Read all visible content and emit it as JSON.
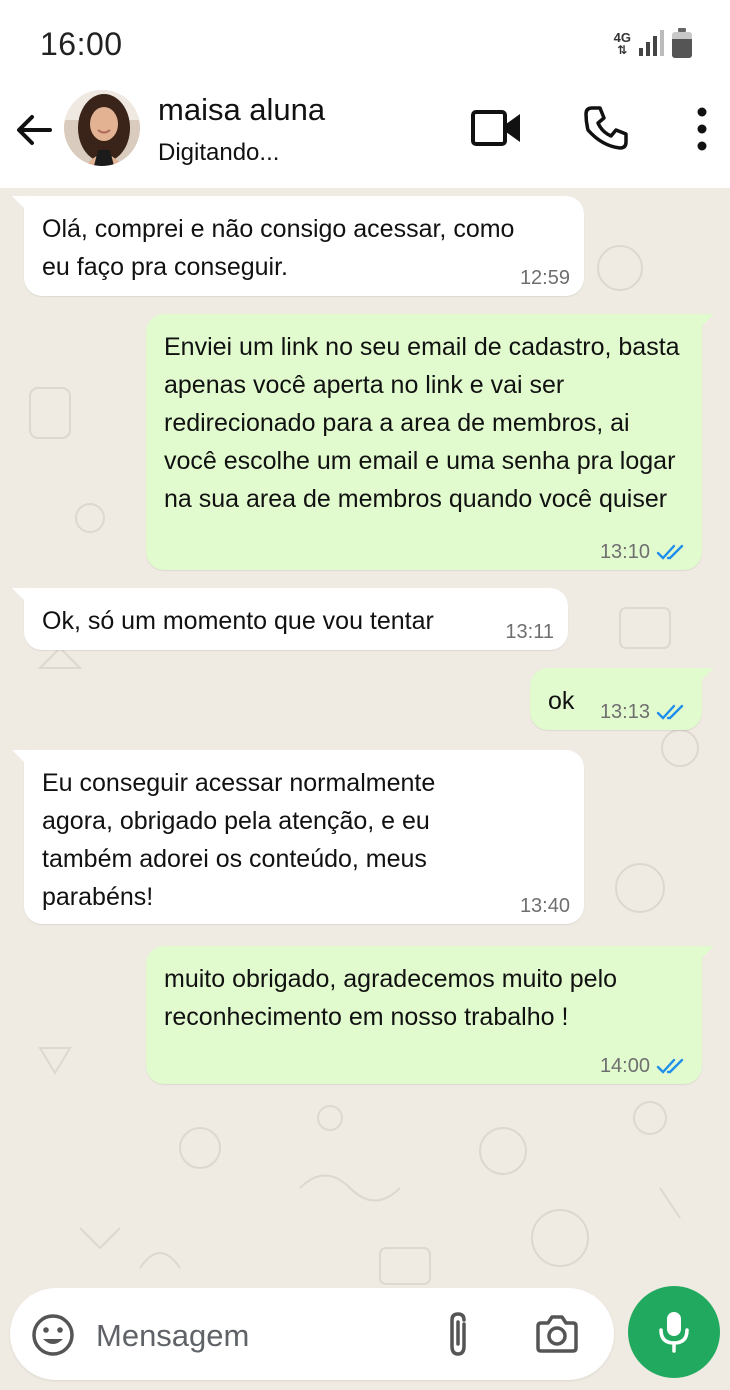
{
  "status_bar": {
    "time": "16:00",
    "network": "4G",
    "icons": [
      "network-4g-icon",
      "signal-icon",
      "battery-icon"
    ],
    "battery_level": 0.75
  },
  "header": {
    "contact_name": "maisa aluna",
    "contact_status": "Digitando...",
    "icons": [
      "back-arrow-icon",
      "video-call-icon",
      "phone-icon",
      "more-vert-icon"
    ]
  },
  "messages": [
    {
      "direction": "in",
      "text": "Olá, comprei e não consigo acessar, como eu faço pra conseguir.",
      "time": "12:59"
    },
    {
      "direction": "out",
      "text": "Enviei um link no seu email de cadastro, basta apenas você aperta no link e vai ser redirecionado para a area de membros, ai você escolhe um email e uma senha pra logar na sua area de membros quando você quiser",
      "time": "13:10",
      "read": true
    },
    {
      "direction": "in",
      "text": "Ok, só um momento que vou tentar",
      "time": "13:11"
    },
    {
      "direction": "out",
      "text": "ok",
      "time": "13:13",
      "read": true
    },
    {
      "direction": "in",
      "text": "Eu conseguir acessar normalmente agora, obrigado pela atenção, e eu também adorei os conteúdo, meus parabéns!",
      "time": "13:40"
    },
    {
      "direction": "out",
      "text": "muito obrigado, agradecemos muito pelo reconhecimento em nosso trabalho !",
      "time": "14:00",
      "read": true
    }
  ],
  "input_bar": {
    "placeholder": "Mensagem",
    "icons": [
      "emoji-icon",
      "attach-icon",
      "camera-icon",
      "mic-icon"
    ]
  },
  "colors": {
    "chat_background": "#efeae2",
    "incoming_bubble": "#ffffff",
    "outgoing_bubble": "#e1fbcf",
    "read_ticks": "#1f8fea",
    "mic_button": "#21a95f"
  }
}
